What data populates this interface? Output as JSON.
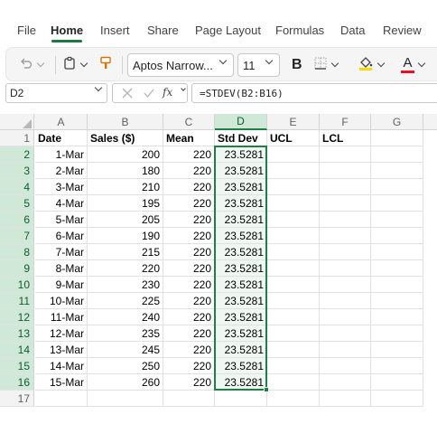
{
  "menu": {
    "tabs": [
      {
        "label": "File",
        "active": false
      },
      {
        "label": "Home",
        "active": true
      },
      {
        "label": "Insert",
        "active": false
      },
      {
        "label": "Share",
        "active": false
      },
      {
        "label": "Page Layout",
        "active": false
      },
      {
        "label": "Formulas",
        "active": false
      },
      {
        "label": "Data",
        "active": false
      },
      {
        "label": "Review",
        "active": false
      }
    ]
  },
  "ribbon": {
    "font_name": "Aptos Narrow...",
    "font_size": "11",
    "bold_label": "B",
    "font_color_letter": "A",
    "fill_color": "#ffd800",
    "font_color": "#e81123"
  },
  "formula_bar": {
    "name_box": "D2",
    "formula": "=STDEV(B2:B16)",
    "fx_label": "fx"
  },
  "sheet": {
    "selected_cell": "D2",
    "selected_column": "D",
    "accent_color": "#1f7f45",
    "columns": [
      "A",
      "B",
      "C",
      "D",
      "E",
      "F",
      "G"
    ],
    "headers": [
      "Date",
      "Sales ($)",
      "Mean",
      "Std Dev",
      "UCL",
      "LCL",
      ""
    ],
    "rows": [
      [
        "1-Mar",
        "200",
        "220",
        "23.5281"
      ],
      [
        "2-Mar",
        "180",
        "220",
        "23.5281"
      ],
      [
        "3-Mar",
        "210",
        "220",
        "23.5281"
      ],
      [
        "4-Mar",
        "195",
        "220",
        "23.5281"
      ],
      [
        "5-Mar",
        "205",
        "220",
        "23.5281"
      ],
      [
        "6-Mar",
        "190",
        "220",
        "23.5281"
      ],
      [
        "7-Mar",
        "215",
        "220",
        "23.5281"
      ],
      [
        "8-Mar",
        "220",
        "220",
        "23.5281"
      ],
      [
        "9-Mar",
        "230",
        "220",
        "23.5281"
      ],
      [
        "10-Mar",
        "225",
        "220",
        "23.5281"
      ],
      [
        "11-Mar",
        "240",
        "220",
        "23.5281"
      ],
      [
        "12-Mar",
        "235",
        "220",
        "23.5281"
      ],
      [
        "13-Mar",
        "245",
        "220",
        "23.5281"
      ],
      [
        "14-Mar",
        "250",
        "220",
        "23.5281"
      ],
      [
        "15-Mar",
        "260",
        "220",
        "23.5281"
      ]
    ],
    "row_numbers": [
      "1",
      "2",
      "3",
      "4",
      "5",
      "6",
      "7",
      "8",
      "9",
      "10",
      "11",
      "12",
      "13",
      "14",
      "15",
      "16",
      "17"
    ]
  }
}
